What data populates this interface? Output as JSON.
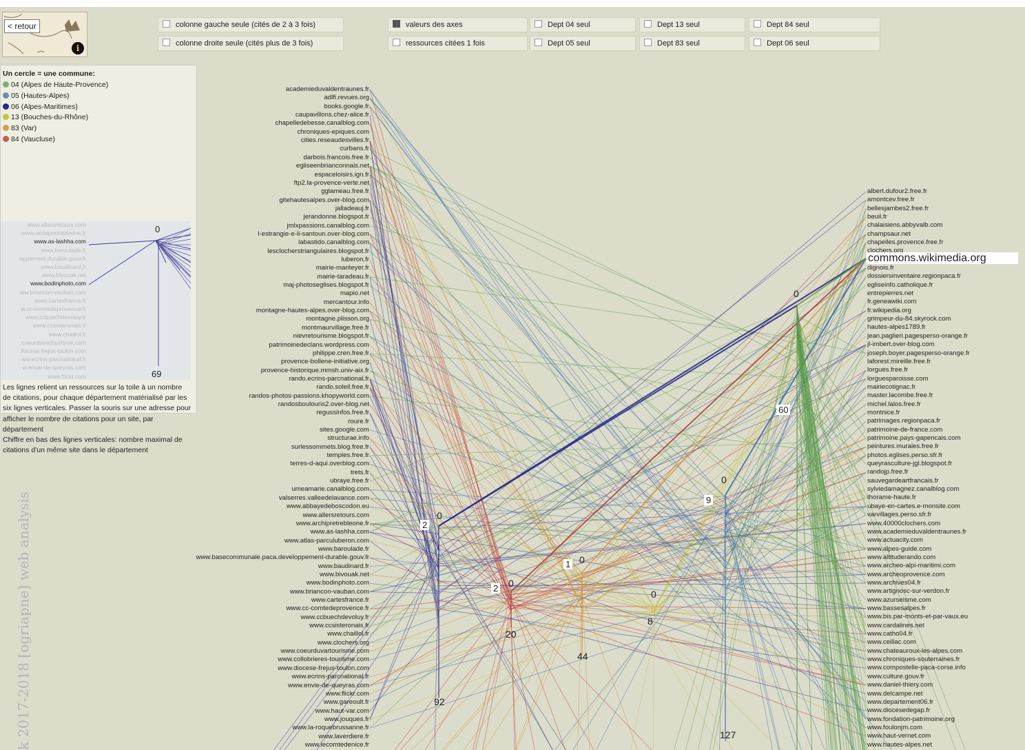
{
  "header": {
    "back_label": "< retour",
    "options": [
      {
        "label": "colonne gauche seule (cités de 2 à 3 fois)",
        "checked": false
      },
      {
        "label": "colonne droite seule (cités plus de 3 fois)",
        "checked": false
      },
      {
        "label": "valeurs des axes",
        "checked": true
      },
      {
        "label": "ressources citées 1 fois",
        "checked": false
      },
      {
        "label": "Dept 04 seul",
        "checked": false
      },
      {
        "label": "Dept 05 seul",
        "checked": false
      },
      {
        "label": "Dept 13 seul",
        "checked": false
      },
      {
        "label": "Dept 83 seul",
        "checked": false
      },
      {
        "label": "Dept 84 seul",
        "checked": false
      },
      {
        "label": "Dept 06 seul",
        "checked": false
      }
    ]
  },
  "legend": {
    "title": "Un cercle = une commune:",
    "items": [
      {
        "label": "04 (Alpes de Haute-Provence)",
        "color": "#7fb07a"
      },
      {
        "label": "05 (Hautes-Alpes)",
        "color": "#6a8fb0"
      },
      {
        "label": "06 (Alpes-Maritimes)",
        "color": "#2a2a8a"
      },
      {
        "label": "13 (Bouches-du-Rhône)",
        "color": "#c8c040"
      },
      {
        "label": "83 (Var)",
        "color": "#d0a050"
      },
      {
        "label": "84 (Vaucluse)",
        "color": "#c06050"
      }
    ],
    "mini_labels": [
      "www.allersretours.com",
      "www.archipretrebleone.fr",
      "www.as-lashha.com",
      "www.baroulade.fr",
      "oppement-durable.gouv.fr",
      "www.baudinard.fr",
      "www.bivouak.net",
      "www.bodinphoto.com",
      "ww.briancon-vauban.com",
      "www.cartesfrance.fr",
      "w.cc-comtedeprovence.fr",
      "www.ccbuechdevoluy.fr",
      "www.ccsisteronais.fr",
      "www.chaillol.fr",
      "coeurduvartourisme.com",
      "liocese-frejus-toulon.com",
      "ww.ecrins-parcnational.fr",
      "w.envie-de-queyras.com",
      "www.flickr.com"
    ],
    "mini_top": "0",
    "mini_bottom": "69",
    "description": "Les lignes relient un ressources sur la toile à un nombre de citations, pour chaque département matérialisé par les six lignes verticales. Passer la souris sur une adresse pour afficher le nombre de citations pour un site, par département",
    "description2": "Chiffre en bas des lignes verticales: nombre maximal de citations d'un même site dans le département"
  },
  "watermark": "k 2017-2018 [ogriapne] web analysis",
  "left_sites": [
    "academieduvaldentraunes.fr",
    "adlfi.revues.org",
    "books.google.fr",
    "caupavillons.chez-alice.fr",
    "chapelledebesse.canalblog.com",
    "chroniques-epiques.com",
    "cities.reseaudesvilles.fr",
    "curbans.fr",
    "darbois.francois.free.fr",
    "egliseenbrianconnais.net",
    "espaceloisirs.ign.fr",
    "ftp2.la-provence-verte.net",
    "gglameau.free.fr",
    "gitehautesalpes.over-blog.com",
    "jalladeauj.fr",
    "jerandonne.blogspot.fr",
    "jmlxpassions.canalblog.com",
    "l-estrangie-e-li-santoun.over-blog.com",
    "labastido.canalblog.com",
    "lesclocherstriangulaires.blogspot.fr",
    "luberon.fr",
    "mairie-manteyer.fr",
    "mairie-taradeau.fr",
    "maj-photoseglises.blogspot.fr",
    "mapio.net",
    "mercantour.info",
    "montagne-hautes-alpes.over-blog.com",
    "montagne.plisson.org",
    "montmaurvillage.free.fr",
    "nievretourisme.blogspot.fr",
    "patrimoinedeclans.wordpress.com",
    "philippe.cren.free.fr",
    "provence-bollene-initiative.org",
    "provence-historique.mmsh.univ-aix.fr",
    "rando.ecrins-parcnational.fr",
    "rando.soleil.free.fr",
    "randos-photos-passions.khopyworld.com",
    "randosboulouris2.over-blog.net",
    "regussinfos.free.fr",
    "roure.fr",
    "sites.google.com",
    "structurae.info",
    "surlessommets.blog.free.fr",
    "temples.free.fr",
    "terres-d-aqui.overblog.com",
    "trets.fr",
    "ubraye.free.fr",
    "umeamarie.canalblog.com",
    "valserres.valleedelavance.com",
    "www.abbayedeboscodon.eu",
    "www.allersretours.com",
    "www.archipretrebleone.fr",
    "www.as-lashha.com",
    "www.atlas-parculuberon.com",
    "www.baroulade.fr",
    "www.basecommunale.paca.developpement-durable.gouv.fr",
    "www.baudinard.fr",
    "www.bivouak.net",
    "www.bodinphoto.com",
    "www.briancon-vauban.com",
    "www.cartesfrance.fr",
    "www.cc-comtedeprovence.fr",
    "www.ccbuechdevoluy.fr",
    "www.ccsisteronais.fr",
    "www.chaillol.fr",
    "www.clochers.org",
    "www.coeurduvartourisme.com",
    "www.collobrieres-tourisme.com",
    "www.diocese-frejus-toulon.com",
    "www.ecrins-parcnational.fr",
    "www.envie-de-queyras.com",
    "www.flickr.com",
    "www.gareoult.fr",
    "www.haut-var.com",
    "www.jouques.fr",
    "www.la-roquebrussanne.fr",
    "www.laverdiere.fr",
    "www.lecomtedenice.fr"
  ],
  "right_sites_top": [
    "albert.dufour2.free.fr",
    "amontcev.free.fr",
    "bellesjambes2.free.fr",
    "beuil.fr",
    "chalaisiens.abbyvalb.com",
    "champsaur.net",
    "chapelles.provence.free.fr",
    "clochers.org"
  ],
  "right_highlight": "commons.wikimedia.org",
  "right_sites": [
    "dignois.fr",
    "dossiersinventaire.regionpaca.fr",
    "egliseinfo.catholique.fr",
    "entrepierres.net",
    "fr.geneawiki.com",
    "fr.wikipedia.org",
    "grimpeur-du-84.skyrock.com",
    "hautes-alpes1789.fr",
    "jean.paglieri.pagesperso-orange.fr",
    "jl-imbert.over-blog.com",
    "joseph.boyer.pagesperso-orange.fr",
    "laforest.mireille.free.fr",
    "lorgues.free.fr",
    "lorguesparoisse.com",
    "mairiecotignac.fr",
    "master.lacombe.free.fr",
    "michel.lalos.free.fr",
    "montnice.fr",
    "patrimages.regionpaca.fr",
    "patrimoine-de-france.com",
    "patrimoine.pays-gapencais.com",
    "peintures.murales.free.fr",
    "photos.eglises.perso.sfr.fr",
    "queyrasculture-jgl.blogspot.fr",
    "randojp.free.fr",
    "sauvegardeartfrancais.fr",
    "sylviedamagnez.canalblog.com",
    "thorame-haute.fr",
    "ubaye-en-cartes.e-monsite.com",
    "varvillages.perso.sfr.fr",
    "www.40000clochers.com",
    "www.academieduvaldentraunes.fr",
    "www.actuacity.com",
    "www.alpes-guide.com",
    "www.altituderando.com",
    "www.archeo-alpi-maritimi.com",
    "www.archeoprovence.com",
    "www.archives04.fr",
    "www.artignosc-sur-verdon.fr",
    "www.azurseisme.com",
    "www.bassesalpes.fr",
    "www.bis.par-monts-et-par-vaux.eu",
    "www.cardalines.net",
    "www.catho04.fr",
    "www.ceillac.com",
    "www.chateauroux-les-alpes.com",
    "www.chroniques-souterraines.fr",
    "www.compostelle-paca-corse.info",
    "www.culture.gouv.fr",
    "www.daniel-thiery.com",
    "www.delcampe.net",
    "www.departement06.fr",
    "www.diocesedegap.fr",
    "www.fondation-patrimoine.org",
    "www.foulonjm.com",
    "www.haut-vernet.com",
    "www.hautes-alpes.net"
  ],
  "axes": [
    {
      "dept": "06",
      "color": "#2a2a8a",
      "top": "0",
      "hover": "2",
      "bottom": "92"
    },
    {
      "dept": "84",
      "color": "#c03030",
      "top": "0",
      "hover": "2",
      "bottom": "20"
    },
    {
      "dept": "83",
      "color": "#d09030",
      "top": "0",
      "hover": "1",
      "bottom": "44"
    },
    {
      "dept": "13",
      "color": "#c8c040",
      "top": "0",
      "bottom": "8"
    },
    {
      "dept": "05",
      "color": "#3a6aa8",
      "top": "0",
      "hover": "9",
      "bottom": "127"
    },
    {
      "dept": "04",
      "color": "#5a9a4a",
      "top": "0",
      "hover": "60"
    }
  ]
}
